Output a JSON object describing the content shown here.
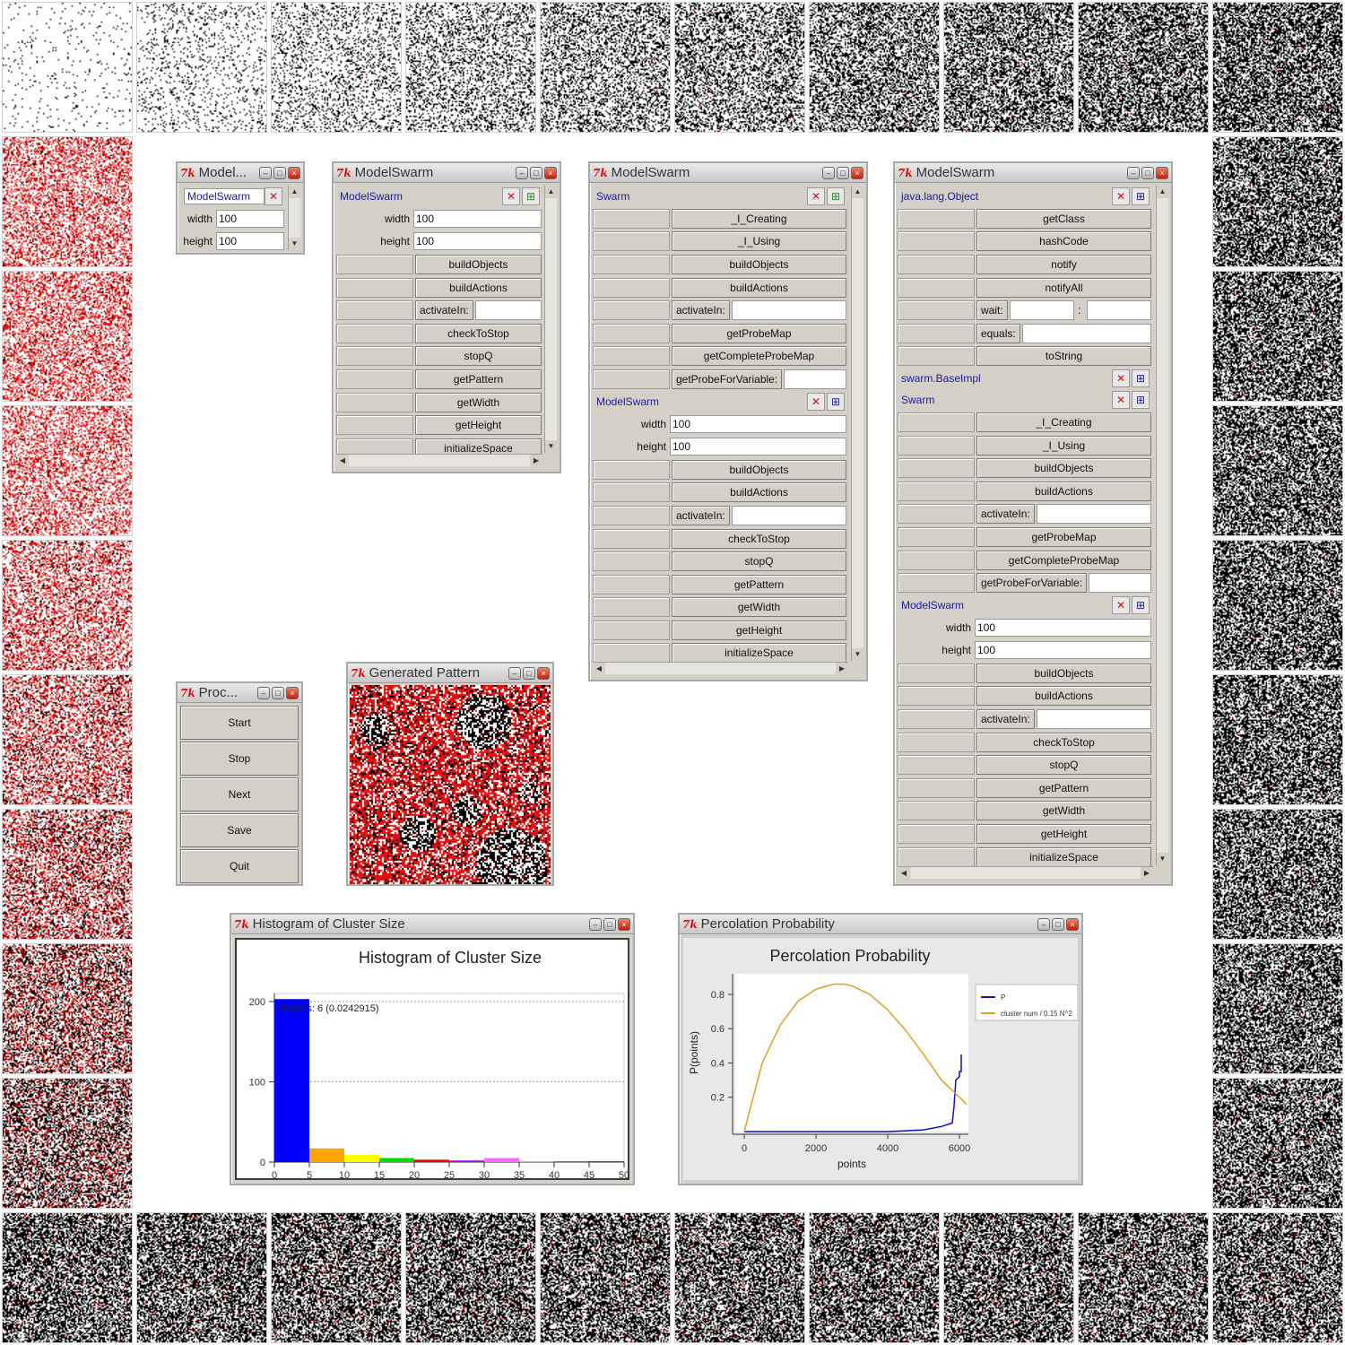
{
  "app": {
    "logo": "7k"
  },
  "tiles": [
    {
      "density": 0.04,
      "red": 0
    },
    {
      "density": 0.12,
      "red": 0.005
    },
    {
      "density": 0.2,
      "red": 0.005
    },
    {
      "density": 0.28,
      "red": 0.005
    },
    {
      "density": 0.34,
      "red": 0.005
    },
    {
      "density": 0.4,
      "red": 0.005
    },
    {
      "density": 0.45,
      "red": 0.005
    },
    {
      "density": 0.5,
      "red": 0.005
    },
    {
      "density": 0.54,
      "red": 0.005
    },
    {
      "density": 0.58,
      "red": 0.005
    },
    {
      "density": 0.58,
      "red": 0.005
    },
    {
      "density": 0.58,
      "red": 0.005
    },
    {
      "density": 0.58,
      "red": 0.005
    },
    {
      "density": 0.58,
      "red": 0.005
    },
    {
      "density": 0.58,
      "red": 0.005
    },
    {
      "density": 0.58,
      "red": 0.005
    },
    {
      "density": 0.58,
      "red": 0.01
    },
    {
      "density": 0.58,
      "red": 0.02
    },
    {
      "density": 0.58,
      "red": 0.02
    },
    {
      "density": 0.58,
      "red": 0.03
    },
    {
      "density": 0.58,
      "red": 0.03
    },
    {
      "density": 0.58,
      "red": 0.03
    },
    {
      "density": 0.58,
      "red": 0.04
    },
    {
      "density": 0.58,
      "red": 0.03
    },
    {
      "density": 0.58,
      "red": 0.03
    },
    {
      "density": 0.58,
      "red": 0.04
    },
    {
      "density": 0.58,
      "red": 0.03
    },
    {
      "density": 0.58,
      "red": 0.04
    },
    {
      "density": 0.55,
      "red": 0.3
    },
    {
      "density": 0.52,
      "red": 0.45
    },
    {
      "density": 0.48,
      "red": 0.6
    },
    {
      "density": 0.45,
      "red": 0.7
    },
    {
      "density": 0.42,
      "red": 0.8
    },
    {
      "density": 0.4,
      "red": 0.92
    },
    {
      "density": 0.42,
      "red": 0.92
    },
    {
      "density": 0.42,
      "red": 0.9
    }
  ],
  "windows": {
    "model_small": {
      "title": "Model...",
      "header": "ModelSwarm",
      "vars": [
        {
          "label": "width",
          "value": "100"
        },
        {
          "label": "height",
          "value": "100"
        }
      ]
    },
    "model_swarm_1": {
      "title": "ModelSwarm",
      "header": "ModelSwarm",
      "vars": [
        {
          "label": "width",
          "value": "100"
        },
        {
          "label": "height",
          "value": "100"
        }
      ],
      "methods": [
        "buildObjects",
        "buildActions",
        "activateIn:",
        "checkToStop",
        "stopQ",
        "getPattern",
        "getWidth",
        "getHeight",
        "initializeSpace"
      ]
    },
    "model_swarm_2": {
      "title": "ModelSwarm",
      "section1": "Swarm",
      "methods1": [
        "_I_Creating",
        "_I_Using",
        "buildObjects",
        "buildActions",
        "activateIn:",
        "getProbeMap",
        "getCompleteProbeMap",
        "getProbeForVariable:"
      ],
      "section2": "ModelSwarm",
      "vars": [
        {
          "label": "width",
          "value": "100"
        },
        {
          "label": "height",
          "value": "100"
        }
      ],
      "methods2": [
        "buildObjects",
        "buildActions",
        "activateIn:",
        "checkToStop",
        "stopQ",
        "getPattern",
        "getWidth",
        "getHeight",
        "initializeSpace"
      ]
    },
    "model_swarm_3": {
      "title": "ModelSwarm",
      "section1": "java.lang.Object",
      "methods1": [
        "getClass",
        "hashCode",
        "notify",
        "notifyAll",
        "wait:",
        "equals:",
        "toString"
      ],
      "section_base": "swarm.BaseImpl",
      "section2": "Swarm",
      "methods2": [
        "_I_Creating",
        "_I_Using",
        "buildObjects",
        "buildActions",
        "activateIn:",
        "getProbeMap",
        "getCompleteProbeMap",
        "getProbeForVariable:"
      ],
      "section3": "ModelSwarm",
      "vars": [
        {
          "label": "width",
          "value": "100"
        },
        {
          "label": "height",
          "value": "100"
        }
      ],
      "methods3": [
        "buildObjects",
        "buildActions",
        "activateIn:",
        "checkToStop",
        "stopQ",
        "getPattern",
        "getWidth",
        "getHeight",
        "initializeSpace"
      ]
    },
    "process": {
      "title": "Proc...",
      "buttons": [
        "Start",
        "Stop",
        "Next",
        "Save",
        "Quit"
      ]
    },
    "pattern": {
      "title": "Generated Pattern"
    },
    "histogram": {
      "title": "Histogram of Cluster Size"
    },
    "percolation": {
      "title": "Percolation Probability"
    }
  },
  "chart_data": [
    {
      "type": "bar",
      "title": "Histogram of Cluster Size",
      "annotation": "clusters: 6 (0.0242915)",
      "x_ticks": [
        "0",
        "5",
        "10",
        "15",
        "20",
        "25",
        "30",
        "35",
        "40",
        "45",
        "50"
      ],
      "y_ticks": [
        "0",
        "100",
        "200"
      ],
      "xlim": [
        0,
        50
      ],
      "ylim": [
        0,
        210
      ],
      "bins": [
        {
          "x0": 0,
          "x1": 5,
          "value": 203,
          "color": "#0000ff"
        },
        {
          "x0": 5,
          "x1": 10,
          "value": 17,
          "color": "#ffa500"
        },
        {
          "x0": 10,
          "x1": 15,
          "value": 9,
          "color": "#ffff00"
        },
        {
          "x0": 15,
          "x1": 20,
          "value": 5,
          "color": "#00dd00"
        },
        {
          "x0": 20,
          "x1": 25,
          "value": 3,
          "color": "#ff0000"
        },
        {
          "x0": 25,
          "x1": 30,
          "value": 2,
          "color": "#aa00ff"
        },
        {
          "x0": 30,
          "x1": 35,
          "value": 5,
          "color": "#ff66ff"
        },
        {
          "x0": 35,
          "x1": 40,
          "value": 1,
          "color": "#00ffff"
        },
        {
          "x0": 40,
          "x1": 45,
          "value": 1,
          "color": "#00aa00"
        },
        {
          "x0": 45,
          "x1": 50,
          "value": 1,
          "color": "#006600"
        }
      ],
      "grid": true
    },
    {
      "type": "line",
      "title": "Percolation Probability",
      "xlabel": "points",
      "ylabel": "P(points)",
      "x_ticks": [
        "0",
        "2000",
        "4000",
        "6000"
      ],
      "y_ticks": [
        "0.2",
        "0.4",
        "0.6",
        "0.8"
      ],
      "xlim": [
        -250,
        6250
      ],
      "ylim": [
        0,
        0.92
      ],
      "legend": "right",
      "series": [
        {
          "name": "P",
          "color": "#1010c0",
          "x": [
            0,
            1000,
            2000,
            3000,
            4000,
            5000,
            5500,
            5800,
            5850,
            5900,
            6000,
            6000,
            6050,
            6050
          ],
          "y": [
            0.0,
            0.0,
            0.0,
            0.0,
            0.0,
            0.01,
            0.03,
            0.05,
            0.15,
            0.3,
            0.32,
            0.35,
            0.35,
            0.45
          ]
        },
        {
          "name": "cluster num / 0.15 N^2",
          "color": "#e0a020",
          "x": [
            0,
            500,
            1000,
            1500,
            2000,
            2500,
            2800,
            3000,
            3500,
            4000,
            4500,
            5000,
            5500,
            6000,
            6200
          ],
          "y": [
            0.0,
            0.4,
            0.62,
            0.76,
            0.83,
            0.86,
            0.86,
            0.85,
            0.8,
            0.71,
            0.59,
            0.45,
            0.3,
            0.2,
            0.16
          ]
        }
      ]
    }
  ]
}
